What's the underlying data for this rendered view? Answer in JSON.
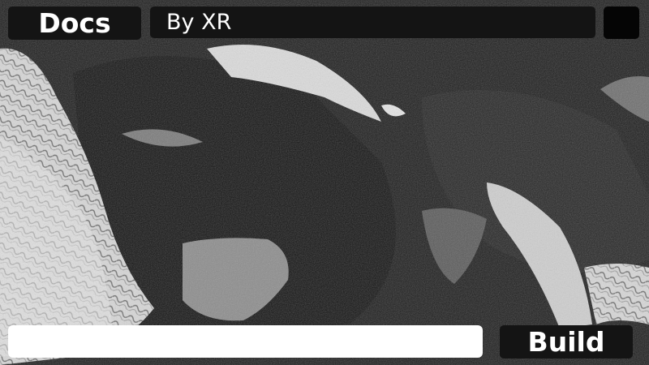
{
  "header": {
    "docs_label": "Docs",
    "author_text": "By XR"
  },
  "footer": {
    "input_value": "",
    "input_placeholder": "",
    "build_label": "Build"
  },
  "colors": {
    "bar_background": "#141414",
    "square_button": "#050505",
    "input_background": "#ffffff",
    "text": "#ffffff"
  }
}
